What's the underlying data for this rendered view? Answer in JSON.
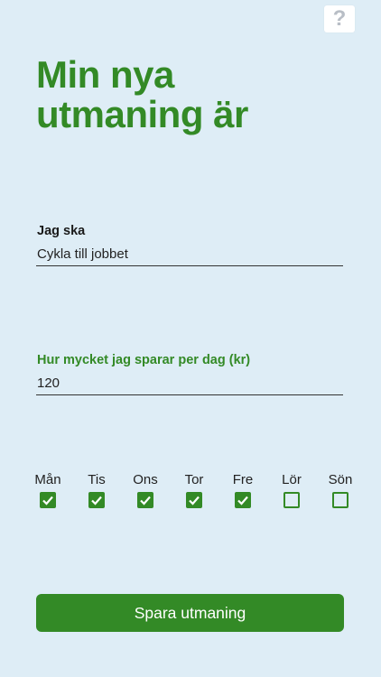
{
  "help": {
    "icon": "question-icon",
    "glyph": "?"
  },
  "title": {
    "line1": "Min nya",
    "line2": "utmaning är"
  },
  "activity": {
    "label": "Jag ska",
    "value": "Cykla till jobbet"
  },
  "savings": {
    "label": "Hur mycket jag sparar per dag (kr)",
    "value": "120"
  },
  "days": [
    {
      "label": "Mån",
      "checked": true
    },
    {
      "label": "Tis",
      "checked": true
    },
    {
      "label": "Ons",
      "checked": true
    },
    {
      "label": "Tor",
      "checked": true
    },
    {
      "label": "Fre",
      "checked": true
    },
    {
      "label": "Lör",
      "checked": false
    },
    {
      "label": "Sön",
      "checked": false
    }
  ],
  "save_button": {
    "label": "Spara utmaning"
  },
  "colors": {
    "accent": "#338a26",
    "background": "#deedf6"
  }
}
